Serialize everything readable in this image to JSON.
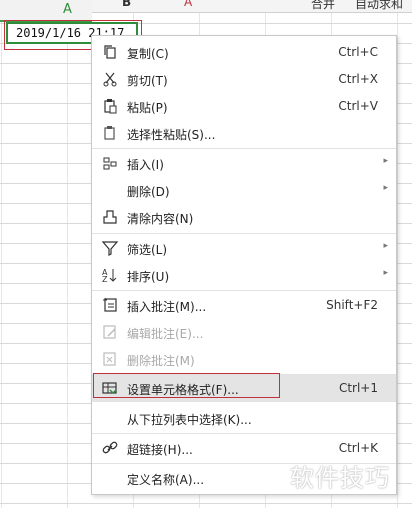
{
  "toolbar": {
    "items": [
      "B",
      "A",
      "合并",
      "自动求和"
    ]
  },
  "sheet": {
    "column_label": "A",
    "cell_value": "2019/1/16  21:17"
  },
  "menu": {
    "items": [
      {
        "label": "复制(C)",
        "shortcut": "Ctrl+C",
        "icon": "copy-icon"
      },
      {
        "label": "剪切(T)",
        "shortcut": "Ctrl+X",
        "icon": "scissors-icon"
      },
      {
        "label": "粘贴(P)",
        "shortcut": "Ctrl+V",
        "icon": "paste-icon"
      },
      {
        "label": "选择性粘贴(S)...",
        "shortcut": "",
        "icon": "paste-special-icon"
      },
      {
        "label": "插入(I)",
        "shortcut": "",
        "icon": "insert-icon",
        "submenu": true
      },
      {
        "label": "删除(D)",
        "shortcut": "",
        "icon": "",
        "submenu": true
      },
      {
        "label": "清除内容(N)",
        "shortcut": "",
        "icon": "eraser-icon"
      },
      {
        "label": "筛选(L)",
        "shortcut": "",
        "icon": "filter-icon",
        "submenu": true
      },
      {
        "label": "排序(U)",
        "shortcut": "",
        "icon": "sort-icon",
        "submenu": true
      },
      {
        "label": "插入批注(M)...",
        "shortcut": "Shift+F2",
        "icon": "insert-comment-icon"
      },
      {
        "label": "编辑批注(E)...",
        "shortcut": "",
        "icon": "edit-comment-icon",
        "disabled": true
      },
      {
        "label": "删除批注(M)",
        "shortcut": "",
        "icon": "delete-comment-icon",
        "disabled": true
      },
      {
        "label": "设置单元格格式(F)...",
        "shortcut": "Ctrl+1",
        "icon": "format-cells-icon",
        "highlighted": true
      },
      {
        "label": "从下拉列表中选择(K)...",
        "shortcut": "",
        "icon": ""
      },
      {
        "label": "超链接(H)...",
        "shortcut": "Ctrl+K",
        "icon": "link-icon"
      },
      {
        "label": "定义名称(A)...",
        "shortcut": "",
        "icon": ""
      }
    ]
  },
  "watermark": "软件技巧"
}
